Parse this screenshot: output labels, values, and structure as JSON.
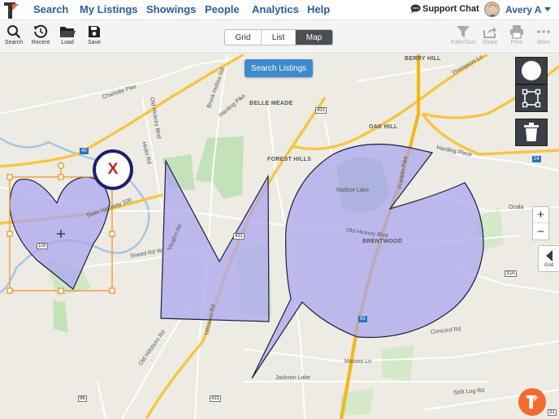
{
  "nav": {
    "items": [
      "Search",
      "My Listings",
      "Showings",
      "People",
      "Analytics",
      "Help"
    ],
    "support_label": "Support Chat",
    "user_name": "Avery A"
  },
  "toolbar": {
    "left_tools": [
      {
        "label": "Search",
        "icon": "search-icon"
      },
      {
        "label": "Recent",
        "icon": "history-icon"
      },
      {
        "label": "Load",
        "icon": "folder-icon"
      },
      {
        "label": "Save",
        "icon": "save-icon"
      }
    ],
    "view_options": [
      "Grid",
      "List",
      "Map"
    ],
    "active_view": "Map",
    "right_tools": [
      {
        "label": "Filter/Sort",
        "icon": "filter-icon"
      },
      {
        "label": "Share",
        "icon": "share-icon"
      },
      {
        "label": "Print",
        "icon": "print-icon"
      },
      {
        "label": "More",
        "icon": "more-icon"
      }
    ]
  },
  "map": {
    "search_button": "Search Listings",
    "zoom_in": "+",
    "zoom_out": "−",
    "grid_tab_label": "Grid",
    "delete_marker": "X",
    "places": [
      "BERRY HILL",
      "BELLE MEADE",
      "OAK HILL",
      "FOREST HILLS",
      "BRENTWOOD"
    ],
    "roads": [
      "Charlotte Pike",
      "Harding Pike",
      "Old Hickory Blvd",
      "Hicks Rd",
      "State Highway 100",
      "Sneed Rd W",
      "Vaughn Rd",
      "Hillsboro Rd",
      "Old Hillsboro Rd",
      "Franklin Pike",
      "Harding Place",
      "Ocala",
      "Old Hickory Blvd",
      "Radnor Lake",
      "Concord Rd",
      "Moores Ln",
      "Jackson Lake",
      "Split Log Rd",
      "Brook Hollow Rd",
      "Thompson Ln"
    ],
    "shields": [
      "40",
      "431",
      "24",
      "100",
      "431",
      "31A",
      "65",
      "96",
      "431",
      "31"
    ]
  },
  "colors": {
    "nav_text": "#2a5f9e",
    "accent_button": "#3d8ad0",
    "polygon_fill": "#a9a4f0",
    "polygon_stroke": "#1c1e3e",
    "edit_handles": "#f28c1e",
    "fab": "#f26a2e"
  }
}
